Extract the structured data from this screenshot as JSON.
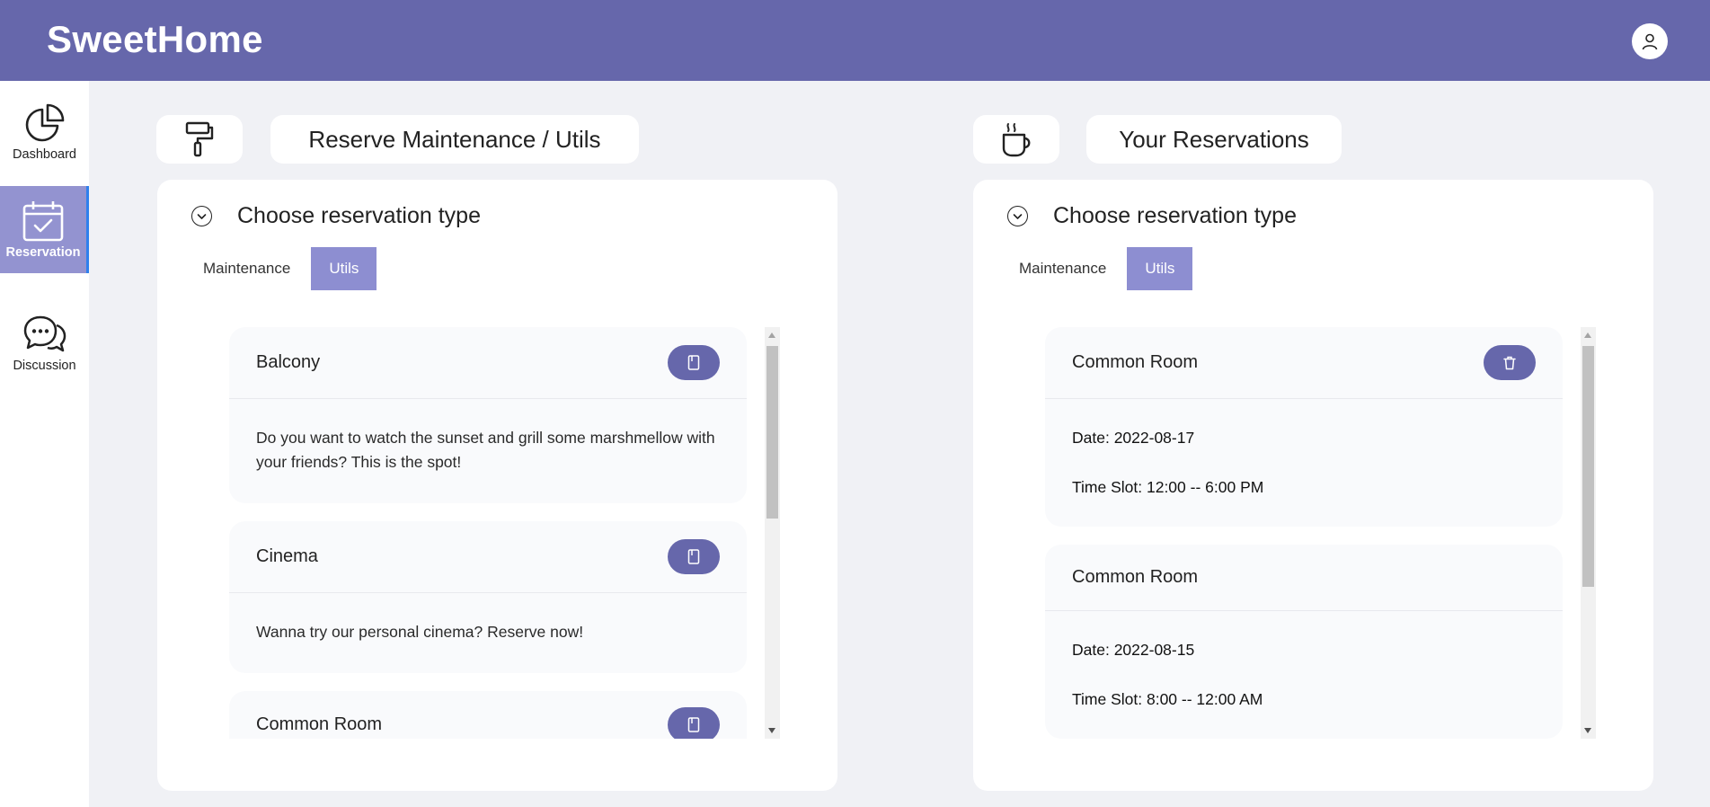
{
  "app": {
    "title": "SweetHome"
  },
  "header": {
    "user_icon": "user-icon"
  },
  "sidebar": {
    "items": [
      {
        "label": "Dashboard",
        "icon": "pie-chart-icon"
      },
      {
        "label": "Reservation",
        "icon": "calendar-check-icon",
        "active": true
      },
      {
        "label": "Discussion",
        "icon": "chat-bubbles-icon"
      }
    ]
  },
  "left": {
    "chip_icon": "paint-roller-icon",
    "chip_title": "Reserve Maintenance / Utils",
    "panel_title": "Choose reservation type",
    "tabs": [
      "Maintenance",
      "Utils"
    ],
    "active_tab": "Utils",
    "cards": [
      {
        "title": "Balcony",
        "description": "Do you want to watch the sunset and grill some marshmellow with your friends? This is the spot!",
        "action_icon": "book-icon"
      },
      {
        "title": "Cinema",
        "description": "Wanna try our personal cinema? Reserve now!",
        "action_icon": "book-icon"
      },
      {
        "title": "Common Room",
        "description": "",
        "action_icon": "book-icon"
      }
    ]
  },
  "right": {
    "chip_icon": "coffee-cup-icon",
    "chip_title": "Your Reservations",
    "panel_title": "Choose reservation type",
    "tabs": [
      "Maintenance",
      "Utils"
    ],
    "active_tab": "Utils",
    "reservations": [
      {
        "title": "Common Room",
        "date": "Date: 2022-08-17",
        "time_slot": "Time Slot: 12:00 -- 6:00 PM",
        "action_icon": "trash-icon"
      },
      {
        "title": "Common Room",
        "date": "Date: 2022-08-15",
        "time_slot": "Time Slot: 8:00 -- 12:00 AM"
      }
    ]
  },
  "colors": {
    "header": "#6667ab",
    "active_tab": "#8d8ed1",
    "sidebar_active": "#9393d0",
    "button": "#6667ab"
  }
}
